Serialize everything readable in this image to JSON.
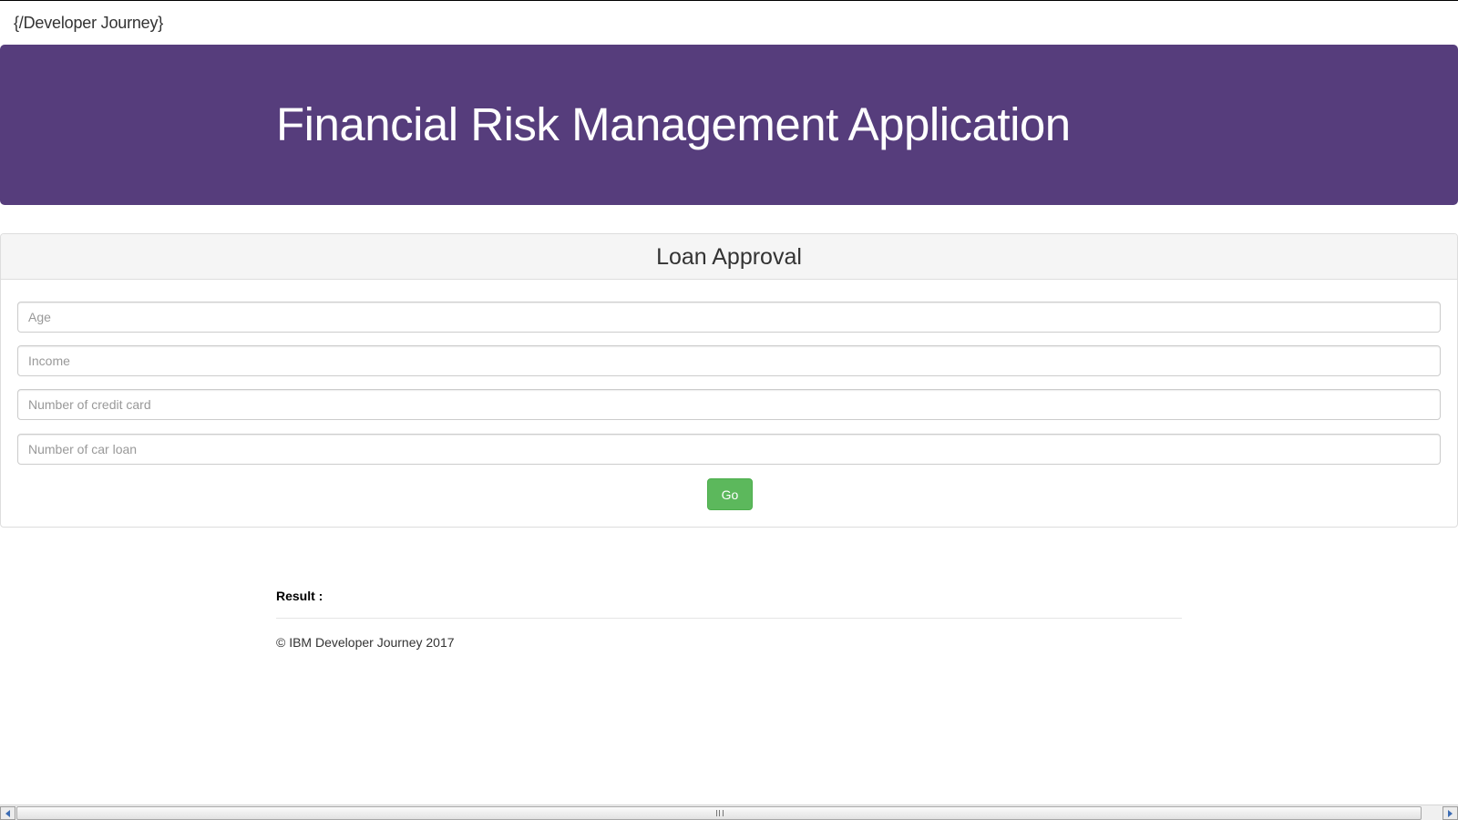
{
  "navbar": {
    "brand": "{/Developer Journey}"
  },
  "jumbotron": {
    "title": "Financial Risk Management Application",
    "background_color": "#563d7c"
  },
  "panel": {
    "title": "Loan Approval",
    "fields": [
      {
        "placeholder": "Age",
        "value": ""
      },
      {
        "placeholder": "Income",
        "value": ""
      },
      {
        "placeholder": "Number of credit card",
        "value": ""
      },
      {
        "placeholder": "Number of car loan",
        "value": ""
      }
    ],
    "submit_label": "Go",
    "submit_color": "#5cb85c"
  },
  "result": {
    "label": "Result :"
  },
  "footer": {
    "text": "© IBM Developer Journey 2017"
  },
  "scrollbar": {
    "left_icon": "arrow-left-icon",
    "right_icon": "arrow-right-icon"
  }
}
